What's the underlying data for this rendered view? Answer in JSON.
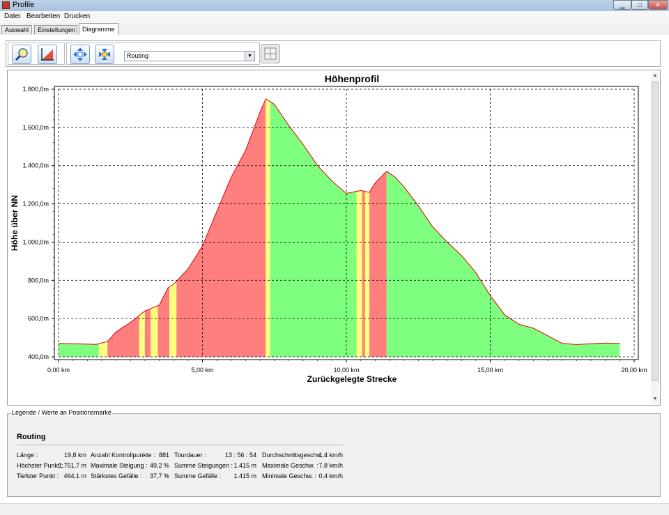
{
  "window": {
    "title": "Profile"
  },
  "menu": [
    "Datei",
    "Bearbeiten",
    "Drucken"
  ],
  "tabs": [
    "Auswahl",
    "Einstellungen",
    "Diagramme"
  ],
  "active_tab": "Diagramme",
  "toolbar": {
    "profile_select": "Routing",
    "icons": [
      "zoom-icon",
      "chart-icon",
      "zoom-in-arrows-icon",
      "zoom-out-arrows-icon",
      "fit-icon"
    ]
  },
  "chart_data": {
    "type": "area",
    "title": "Höhenprofil",
    "xlabel": "Zurückgelegte Strecke",
    "ylabel": "Höhe über NN",
    "xlim": [
      0,
      20
    ],
    "ylim": [
      400,
      1800
    ],
    "x_ticks": [
      "0,00 km",
      "5,00 km",
      "10,00 km",
      "15,00 km",
      "20,00 km"
    ],
    "x_tick_values": [
      0,
      5,
      10,
      15,
      20
    ],
    "y_ticks": [
      "400,0m",
      "600,0m",
      "800,0m",
      "1.000,0m",
      "1.200,0m",
      "1.400,0m",
      "1.600,0m",
      "1.800,0m"
    ],
    "y_tick_values": [
      400,
      600,
      800,
      1000,
      1200,
      1400,
      1600,
      1800
    ],
    "grid": true,
    "colors": {
      "ascent": "#ff7f7f",
      "descent": "#7fff7f",
      "flat": "#ffff80",
      "line": "#e00000"
    },
    "profile": {
      "x": [
        0,
        0.5,
        1.3,
        1.7,
        2.0,
        2.5,
        3.0,
        3.5,
        3.8,
        4.0,
        4.5,
        5.0,
        5.5,
        6.0,
        6.5,
        7.0,
        7.2,
        7.5,
        8.0,
        8.5,
        9.0,
        9.5,
        10.0,
        10.5,
        10.8,
        11.0,
        11.4,
        11.7,
        12.0,
        12.5,
        13.0,
        13.5,
        14.0,
        14.5,
        15.0,
        15.5,
        16.0,
        16.5,
        17.0,
        17.5,
        18.0,
        18.5,
        19.0,
        19.5
      ],
      "y": [
        470,
        468,
        465,
        480,
        530,
        580,
        640,
        670,
        760,
        780,
        860,
        980,
        1160,
        1340,
        1480,
        1680,
        1750,
        1720,
        1610,
        1510,
        1400,
        1320,
        1255,
        1270,
        1260,
        1310,
        1370,
        1340,
        1290,
        1190,
        1080,
        1000,
        930,
        840,
        720,
        620,
        570,
        550,
        510,
        470,
        464,
        468,
        472,
        470
      ]
    },
    "segments": [
      {
        "from": 0,
        "to": 1.4,
        "kind": "descent"
      },
      {
        "from": 1.4,
        "to": 1.7,
        "kind": "flat"
      },
      {
        "from": 1.7,
        "to": 2.8,
        "kind": "ascent"
      },
      {
        "from": 2.8,
        "to": 3.0,
        "kind": "flat"
      },
      {
        "from": 3.0,
        "to": 3.2,
        "kind": "ascent"
      },
      {
        "from": 3.2,
        "to": 3.45,
        "kind": "flat"
      },
      {
        "from": 3.45,
        "to": 3.85,
        "kind": "ascent"
      },
      {
        "from": 3.85,
        "to": 4.1,
        "kind": "flat"
      },
      {
        "from": 4.1,
        "to": 7.2,
        "kind": "ascent"
      },
      {
        "from": 7.2,
        "to": 7.35,
        "kind": "flat"
      },
      {
        "from": 7.35,
        "to": 10.35,
        "kind": "descent"
      },
      {
        "from": 10.35,
        "to": 10.55,
        "kind": "flat"
      },
      {
        "from": 10.55,
        "to": 10.65,
        "kind": "ascent"
      },
      {
        "from": 10.65,
        "to": 10.8,
        "kind": "flat"
      },
      {
        "from": 10.8,
        "to": 11.4,
        "kind": "ascent"
      },
      {
        "from": 11.4,
        "to": 19.5,
        "kind": "descent"
      }
    ]
  },
  "legend": {
    "caption": "Legende / Werte an Positionsmarke",
    "series_name": "Routing",
    "rows": [
      [
        {
          "label": "Länge :",
          "value": "19,8 km"
        },
        {
          "label": "Anzahl Kontrollpunkte :",
          "value": "881"
        },
        {
          "label": "Tourdauer :",
          "value": "13 : 56 : 54"
        },
        {
          "label": "Durchschnittsgeschw. :",
          "value": "1,4 km/h"
        }
      ],
      [
        {
          "label": "Höchster Punkt :",
          "value": "1.751,7 m"
        },
        {
          "label": "Maximale Steigung :",
          "value": "49,2 %"
        },
        {
          "label": "Summe Steigungen :",
          "value": "1.415 m"
        },
        {
          "label": "Maximale Geschw. :",
          "value": "7,8 km/h"
        }
      ],
      [
        {
          "label": "Tiefster Punkt :",
          "value": "464,1 m"
        },
        {
          "label": "Stärkstes Gefälle :",
          "value": "37,7 %"
        },
        {
          "label": "Summe Gefälle :",
          "value": "1.415 m"
        },
        {
          "label": "Minimale Geschw. :",
          "value": "0,4 km/h"
        }
      ]
    ]
  }
}
